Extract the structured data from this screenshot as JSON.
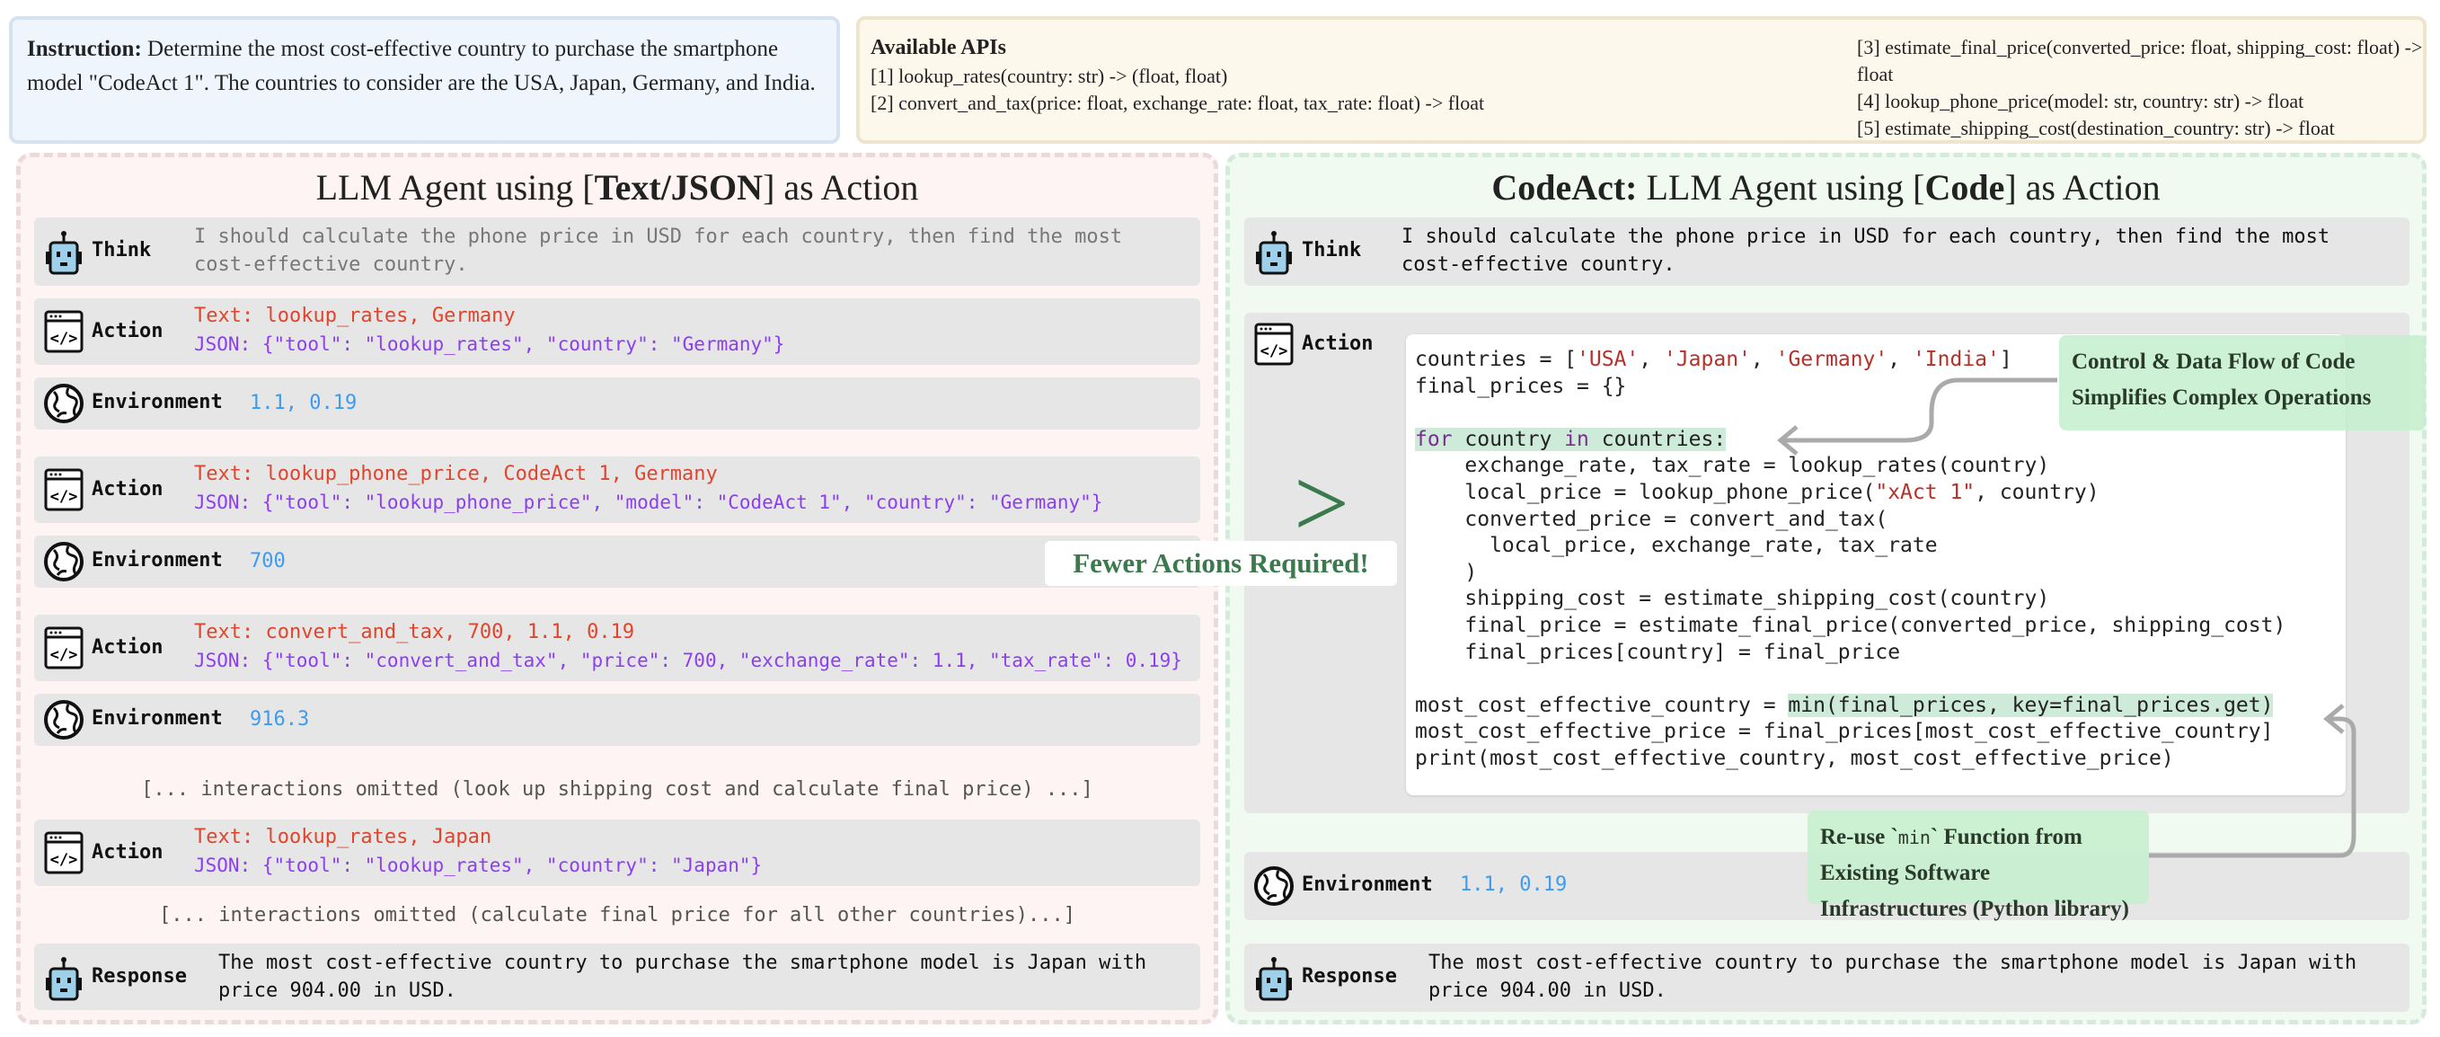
{
  "instruction": {
    "label": "Instruction:",
    "text": "Determine the most cost-effective country to purchase the smartphone model \"CodeAct 1\". The countries to consider are the USA, Japan, Germany, and India."
  },
  "apis": {
    "title": "Available APIs",
    "items": [
      "[1] lookup_rates(country: str) -> (float, float)",
      "[2] convert_and_tax(price: float, exchange_rate: float, tax_rate: float) -> float",
      "[3] estimate_final_price(converted_price: float, shipping_cost: float) -> float",
      "[4] lookup_phone_price(model: str, country: str) -> float",
      "[5] estimate_shipping_cost(destination_country: str) -> float"
    ]
  },
  "left": {
    "title_pre": "LLM Agent using [",
    "title_bold": "Text/JSON",
    "title_post": "] as Action",
    "think": {
      "label": "Think",
      "text": "I should calculate the phone price in USD for each country, then find the most cost-effective country."
    },
    "steps": [
      {
        "label": "Action",
        "text": "Text: lookup_rates, Germany",
        "json": "JSON: {\"tool\": \"lookup_rates\", \"country\": \"Germany\"}"
      },
      {
        "label": "Environment",
        "value": "1.1, 0.19"
      },
      {
        "label": "Action",
        "text": "Text: lookup_phone_price, CodeAct 1, Germany",
        "json": "JSON: {\"tool\": \"lookup_phone_price\", \"model\": \"CodeAct 1\", \"country\": \"Germany\"}"
      },
      {
        "label": "Environment",
        "value": "700"
      },
      {
        "label": "Action",
        "text": "Text: convert_and_tax, 700, 1.1, 0.19",
        "json": "JSON: {\"tool\": \"convert_and_tax\", \"price\": 700, \"exchange_rate\": 1.1, \"tax_rate\": 0.19}"
      },
      {
        "label": "Environment",
        "value": "916.3"
      },
      {
        "label": "Action",
        "text": "Text: lookup_rates, Japan",
        "json": "JSON: {\"tool\": \"lookup_rates\", \"country\": \"Japan\"}"
      }
    ],
    "omitted1": "[... interactions omitted (look up shipping cost and calculate final price) ...]",
    "omitted2": "[... interactions omitted (calculate final price for all other countries)...]",
    "response": {
      "label": "Response",
      "text": "The most cost-effective country to purchase the smartphone model is Japan with price 904.00 in USD."
    }
  },
  "right": {
    "title_bold": "CodeAct:",
    "title_mid": " LLM Agent using [",
    "title_bold2": "Code",
    "title_post": "] as Action",
    "think": {
      "label": "Think",
      "text": "I should calculate the phone price in USD for each country, then find the most cost-effective country."
    },
    "action_label": "Action",
    "code": [
      [
        [
          "countries = [",
          ""
        ],
        [
          "'USA'",
          "s"
        ],
        [
          ", ",
          ""
        ],
        [
          "'Japan'",
          "s"
        ],
        [
          ", ",
          ""
        ],
        [
          "'Germany'",
          "s"
        ],
        [
          ", ",
          ""
        ],
        [
          "'India'",
          "s"
        ],
        [
          "]",
          ""
        ]
      ],
      [
        [
          "final_prices = {}",
          ""
        ]
      ],
      [],
      [
        [
          "for",
          "k hl"
        ],
        [
          " country ",
          "hl"
        ],
        [
          "in",
          "k hl"
        ],
        [
          " countries:",
          "hl"
        ]
      ],
      [
        [
          "    exchange_rate, tax_rate = lookup_rates(country)",
          ""
        ]
      ],
      [
        [
          "    local_price = lookup_phone_price(",
          ""
        ],
        [
          "\"xAct 1\"",
          "s"
        ],
        [
          ", country)",
          ""
        ]
      ],
      [
        [
          "    converted_price = convert_and_tax(",
          ""
        ]
      ],
      [
        [
          "      local_price, exchange_rate, tax_rate",
          ""
        ]
      ],
      [
        [
          "    )",
          ""
        ]
      ],
      [
        [
          "    shipping_cost = estimate_shipping_cost(country)",
          ""
        ]
      ],
      [
        [
          "    final_price = estimate_final_price(converted_price, shipping_cost)",
          ""
        ]
      ],
      [
        [
          "    final_prices[country] = final_price",
          ""
        ]
      ],
      [],
      [
        [
          "most_cost_effective_country = ",
          ""
        ],
        [
          "min(final_prices, key=final_prices.get)",
          "hl"
        ]
      ],
      [
        [
          "most_cost_effective_price = final_prices[most_cost_effective_country]",
          ""
        ]
      ],
      [
        [
          "print(most_cost_effective_country, most_cost_effective_price)",
          ""
        ]
      ]
    ],
    "env": {
      "label": "Environment",
      "value": "1.1, 0.19"
    },
    "response": {
      "label": "Response",
      "text": "The most cost-effective country to purchase the smartphone model is Japan with price 904.00 in USD."
    },
    "callout1": "Control & Data Flow of Code Simplifies Complex Operations",
    "callout2_pre": "Re-use `",
    "callout2_code": "min",
    "callout2_post": "` Function from Existing Software Infrastructures (Python library)"
  },
  "comparison": {
    "symbol": ">",
    "label": "Fewer Actions Required!"
  },
  "colors": {
    "text_action": "#e0452c",
    "json_action": "#8b3ef2",
    "env_value": "#3d9bf0",
    "accent_green": "#3b7a4c"
  }
}
